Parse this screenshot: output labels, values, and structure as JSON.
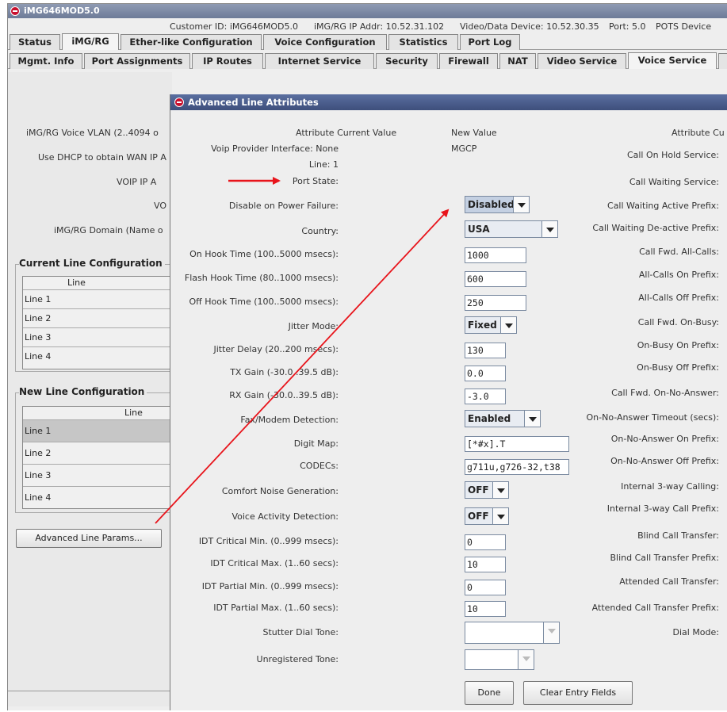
{
  "window": {
    "title": "iMG646MOD5.0"
  },
  "info": {
    "customer_id": "Customer ID: iMG646MOD5.0",
    "ip_addr": "iMG/RG IP Addr: 10.52.31.102",
    "video_device": "Video/Data Device: 10.52.30.35",
    "port": "Port: 5.0",
    "pots_device": "POTS Device"
  },
  "tabs_row1": [
    "Status",
    "iMG/RG",
    "Ether-like Configuration",
    "Voice Configuration",
    "Statistics",
    "Port Log"
  ],
  "tabs_row2": [
    "Mgmt. Info",
    "Port Assignments",
    "IP Routes",
    "Internet Service",
    "Security",
    "Firewall",
    "NAT",
    "Video Service",
    "Voice Service"
  ],
  "left": {
    "labels": [
      "iMG/RG Voice VLAN (2..4094 o",
      "Use DHCP to obtain WAN IP A",
      "VOIP IP A",
      "VO",
      "iMG/RG Domain (Name o"
    ],
    "current_title": "Current Line Configuration",
    "current_header": "Line",
    "current_lines": [
      "Line 1",
      "Line 2",
      "Line 3",
      "Line 4"
    ],
    "new_title": "New Line Configuration",
    "new_header": "Line",
    "new_lines": [
      "Line 1",
      "Line 2",
      "Line 3",
      "Line 4"
    ],
    "advanced_button": "Advanced Line Params..."
  },
  "dialog": {
    "title": "Advanced Line Attributes",
    "col_attr_current": "Attribute Current Value",
    "col_new": "New Value",
    "col_attr_right": "Attribute Cu",
    "voip_provider_label": "Voip Provider Interface: None",
    "voip_provider_new": "MGCP",
    "line_label": "Line: 1",
    "port_state_label": "Port State:",
    "fields": {
      "disable_power": {
        "label": "Disable on Power Failure:",
        "value": "Disabled"
      },
      "country": {
        "label": "Country:",
        "value": "USA"
      },
      "on_hook": {
        "label": "On Hook Time (100..5000 msecs):",
        "value": "1000"
      },
      "flash_hook": {
        "label": "Flash Hook Time (80..1000 msecs):",
        "value": "600"
      },
      "off_hook": {
        "label": "Off Hook Time (100..5000 msecs):",
        "value": "250"
      },
      "jitter_mode": {
        "label": "Jitter Mode:",
        "value": "Fixed"
      },
      "jitter_delay": {
        "label": "Jitter Delay (20..200 msecs):",
        "value": "130"
      },
      "tx_gain": {
        "label": "TX Gain (-30.0..39.5 dB):",
        "value": "0.0"
      },
      "rx_gain": {
        "label": "RX Gain (-30.0..39.5 dB):",
        "value": "-3.0"
      },
      "fax_modem": {
        "label": "Fax/Modem Detection:",
        "value": "Enabled"
      },
      "digit_map": {
        "label": "Digit Map:",
        "value": "[*#x].T"
      },
      "codecs": {
        "label": "CODECs:",
        "value": "g711u,g726-32,t38"
      },
      "comfort_noise": {
        "label": "Comfort Noise Generation:",
        "value": "OFF"
      },
      "vad": {
        "label": "Voice Activity Detection:",
        "value": "OFF"
      },
      "idt_crit_min": {
        "label": "IDT Critical Min. (0..999 msecs):",
        "value": "0"
      },
      "idt_crit_max": {
        "label": "IDT Critical Max. (1..60 secs):",
        "value": "10"
      },
      "idt_part_min": {
        "label": "IDT Partial Min. (0..999 msecs):",
        "value": "0"
      },
      "idt_part_max": {
        "label": "IDT Partial Max. (1..60 secs):",
        "value": "10"
      },
      "stutter": {
        "label": "Stutter Dial Tone:",
        "value": ""
      },
      "unreg": {
        "label": "Unregistered Tone:",
        "value": ""
      }
    },
    "right_labels": [
      "Call On Hold Service:",
      "Call Waiting Service:",
      "Call Waiting Active Prefix:",
      "Call Waiting De-active Prefix:",
      "Call Fwd. All-Calls:",
      "All-Calls On Prefix:",
      "All-Calls Off Prefix:",
      "Call Fwd. On-Busy:",
      "On-Busy On Prefix:",
      "On-Busy Off Prefix:",
      "Call Fwd. On-No-Answer:",
      "On-No-Answer Timeout (secs):",
      "On-No-Answer On Prefix:",
      "On-No-Answer Off Prefix:",
      "Internal 3-way Calling:",
      "Internal 3-way Call Prefix:",
      "Blind Call Transfer:",
      "Blind Call Transfer Prefix:",
      "Attended Call Transfer:",
      "Attended Call Transfer Prefix:",
      "Dial Mode:"
    ],
    "done_button": "Done",
    "clear_button": "Clear Entry Fields"
  },
  "colors": {
    "annotation_arrow": "#e8141b",
    "dialog_title": "#3e4f7c"
  }
}
